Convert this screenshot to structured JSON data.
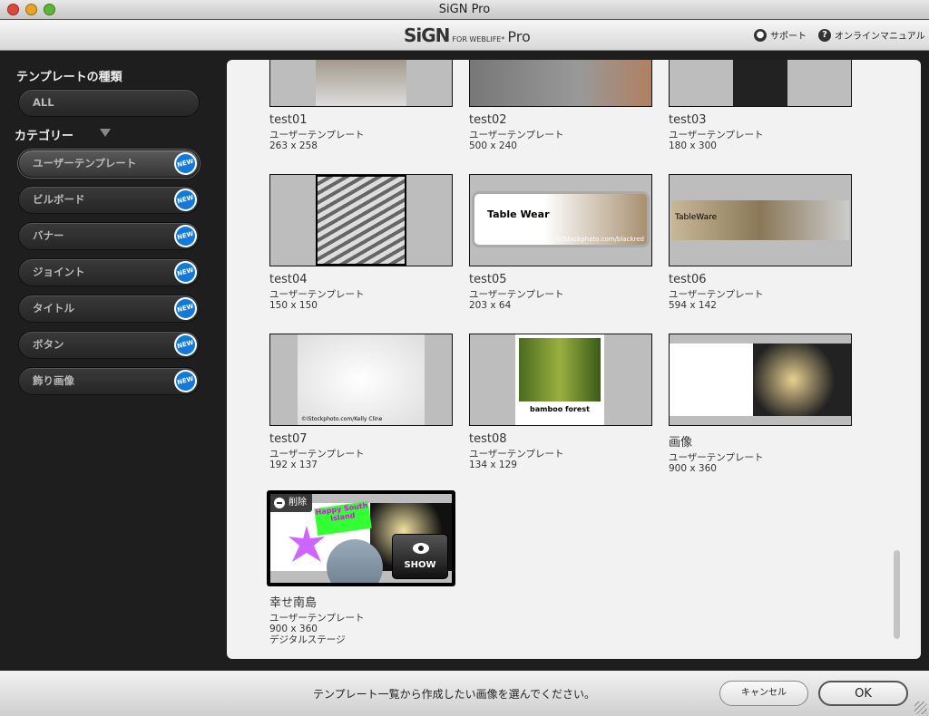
{
  "window": {
    "title": "SiGN Pro"
  },
  "header": {
    "logo_main": "SiGN",
    "logo_sub": "FOR WEBLIFE*",
    "logo_pro": "Pro",
    "support": "サポート",
    "manual": "オンラインマニュアル"
  },
  "sidebar": {
    "type_heading": "テンプレートの種類",
    "all_label": "ALL",
    "category_heading": "カテゴリー",
    "new_badge": "NEW",
    "categories": [
      {
        "label": "ユーザーテンプレート",
        "active": true
      },
      {
        "label": "ビルボード"
      },
      {
        "label": "バナー"
      },
      {
        "label": "ジョイント"
      },
      {
        "label": "タイトル"
      },
      {
        "label": "ボタン"
      },
      {
        "label": "飾り画像"
      }
    ]
  },
  "templates": [
    {
      "name": "test01",
      "type": "ユーザーテンプレート",
      "size": "263 x 258"
    },
    {
      "name": "test02",
      "type": "ユーザーテンプレート",
      "size": "500 x 240"
    },
    {
      "name": "test03",
      "type": "ユーザーテンプレート",
      "size": "180 x 300"
    },
    {
      "name": "test04",
      "type": "ユーザーテンプレート",
      "size": "150 x 150"
    },
    {
      "name": "test05",
      "type": "ユーザーテンプレート",
      "size": "203 x 64",
      "thumb_text": "Table Wear",
      "thumb_credit": "©iStockphoto.com/blackred"
    },
    {
      "name": "test06",
      "type": "ユーザーテンプレート",
      "size": "594 x 142",
      "thumb_text": "TableWare"
    },
    {
      "name": "test07",
      "type": "ユーザーテンプレート",
      "size": "192 x 137",
      "thumb_credit": "©iStockphoto.com/Kelly Cline"
    },
    {
      "name": "test08",
      "type": "ユーザーテンプレート",
      "size": "134 x 129",
      "thumb_text": "bamboo forest"
    },
    {
      "name": "画像",
      "type": "ユーザーテンプレート",
      "size": "900 x 360"
    },
    {
      "name": "幸せ南島",
      "type": "ユーザーテンプレート",
      "size": "900 x 360",
      "category": "デジタルステージ",
      "selected": true,
      "delete_label": "削除",
      "show_label": "SHOW",
      "thumb_text": "Happy South Island"
    }
  ],
  "footer": {
    "message": "テンプレート一覧から作成したい画像を選んでください。",
    "cancel": "キャンセル",
    "ok": "OK"
  },
  "colors": {
    "new_badge": "#1479d8",
    "panel": "#f2f2f2",
    "sidebar": "#1e1e1e"
  }
}
